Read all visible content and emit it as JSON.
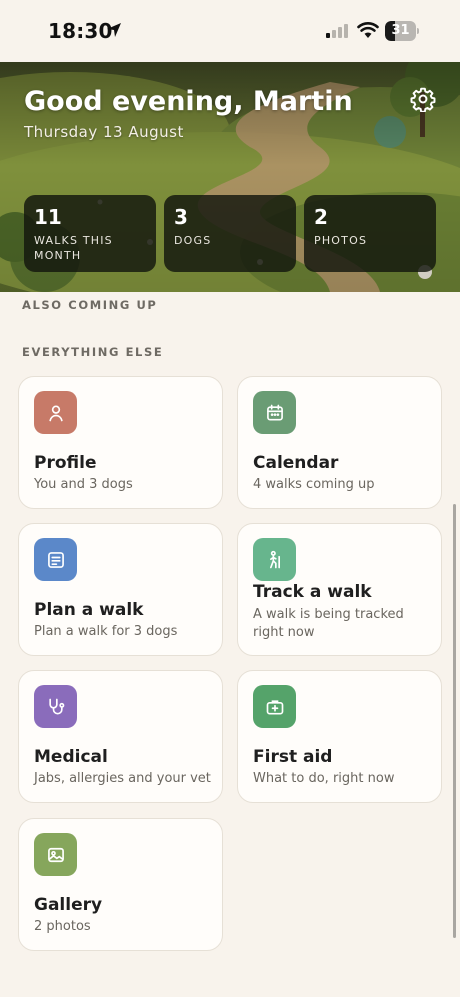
{
  "status_bar": {
    "time": "18:30",
    "battery": "31",
    "battery_level": 0.31
  },
  "hero": {
    "greeting": "Good evening, Martin",
    "date": "Thursday 13 August",
    "stats": [
      {
        "value": "11",
        "label": "Walks this month"
      },
      {
        "value": "3",
        "label": "Dogs"
      },
      {
        "value": "2",
        "label": "Photos"
      }
    ]
  },
  "sections": {
    "also_coming_up": "Also coming up",
    "everything_else": "Everything else"
  },
  "tiles": [
    {
      "title": "Profile",
      "subtitle": "You and 3 dogs",
      "icon": "person-icon",
      "color": "#c77a68"
    },
    {
      "title": "Calendar",
      "subtitle": "4 walks coming up",
      "icon": "calendar-icon",
      "color": "#6a9c74"
    },
    {
      "title": "Plan a walk",
      "subtitle": "Plan a walk for 3 dogs",
      "icon": "notes-icon",
      "color": "#5b88c9"
    },
    {
      "title": "Track a walk",
      "subtitle": "A walk is being tracked right now",
      "icon": "walking-person-icon",
      "color": "#67b58d"
    },
    {
      "title": "Medical",
      "subtitle": "Jabs, allergies and your vet",
      "icon": "stethoscope-icon",
      "color": "#8a6cbb"
    },
    {
      "title": "First aid",
      "subtitle": "What to do, right now",
      "icon": "first-aid-kit-icon",
      "color": "#55a36a"
    },
    {
      "title": "Gallery",
      "subtitle": "2 photos",
      "icon": "image-icon",
      "color": "#86a65c"
    }
  ],
  "colors": {
    "background": "#f8f3ec",
    "card_background": "#fffdfa",
    "stat_card": "#12160e"
  }
}
